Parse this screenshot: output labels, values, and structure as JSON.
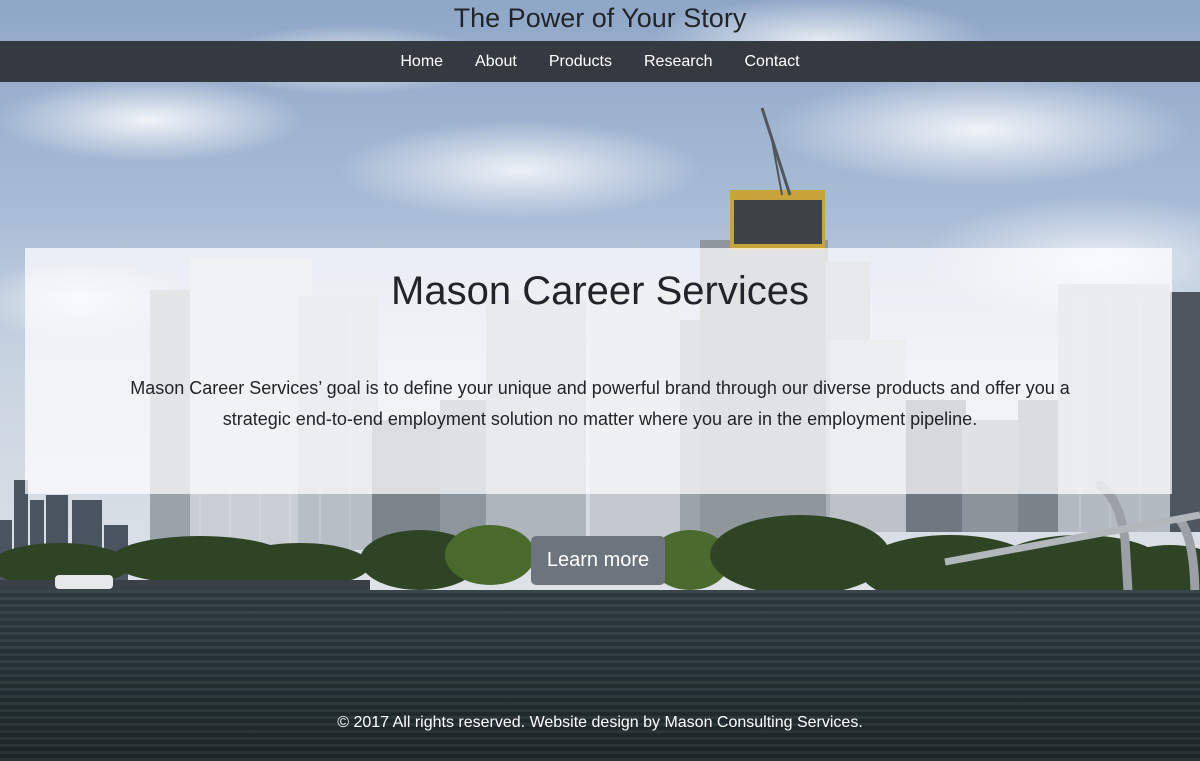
{
  "header": {
    "site_title": "The Power of Your Story"
  },
  "nav": {
    "items": [
      {
        "label": "Home"
      },
      {
        "label": "About"
      },
      {
        "label": "Products"
      },
      {
        "label": "Research"
      },
      {
        "label": "Contact"
      }
    ]
  },
  "hero": {
    "title": "Mason Career Services",
    "description": "Mason Career Services’ goal is to define your unique and powerful brand through our diverse products and offer you a strategic end-to-end employment solution no matter where you are in the employment pipeline.",
    "button_label": "Learn more"
  },
  "footer": {
    "text": "© 2017 All rights reserved. Website design by Mason Consulting Services."
  },
  "colors": {
    "navbar": "#343a40",
    "button": "#6c757d",
    "text": "#212529"
  }
}
